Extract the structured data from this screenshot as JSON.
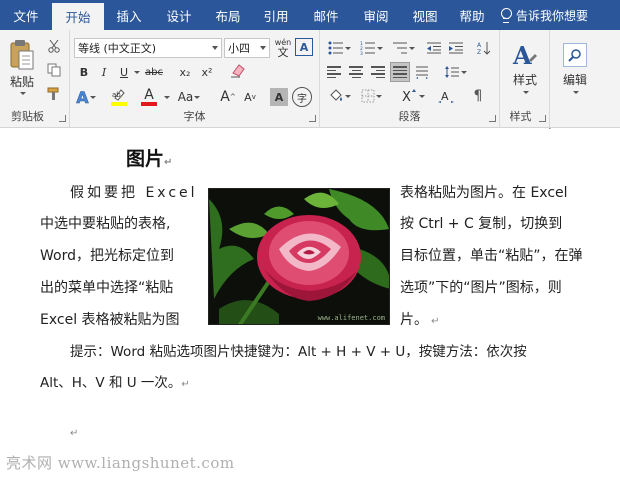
{
  "menu": {
    "tabs": [
      "文件",
      "开始",
      "插入",
      "设计",
      "布局",
      "引用",
      "邮件",
      "审阅",
      "视图",
      "帮助"
    ],
    "active_tab": "开始",
    "tell_me": "告诉我你想要"
  },
  "ribbon": {
    "clipboard": {
      "label": "剪贴板",
      "paste": "粘贴"
    },
    "font": {
      "label": "字体",
      "font_name": "等线 (中文正文)",
      "font_size": "小四",
      "wen_top": "wén",
      "wen_bottom": "文",
      "border_char": "A",
      "bold": "B",
      "italic": "I",
      "underline": "U",
      "strike": "abc",
      "subscript": "x₂",
      "superscript": "x²",
      "grow": "A",
      "shrink": "A",
      "case": "Aa",
      "char_shading": "A",
      "enclose": "字",
      "highlight_color": "#ffff00",
      "font_color": "#e0191c"
    },
    "paragraph": {
      "label": "段落"
    },
    "styles": {
      "label": "样式",
      "button": "样式"
    },
    "editing": {
      "button": "编辑"
    }
  },
  "document": {
    "heading": "图片",
    "lines_left": [
      "假如要把   Excel",
      "中选中要粘贴的表格,",
      "Word，把光标定位到",
      "出的菜单中选择“粘贴",
      "Excel 表格被粘贴为图"
    ],
    "lines_right": [
      "表格粘贴为图片。在 Excel",
      "按 Ctrl + C 复制，切换到",
      "目标位置，单击“粘贴”，在弹",
      "选项”下的“图片”图标，则",
      "片。"
    ],
    "tip_line1": "提示：Word 粘贴选项图片快捷键为：Alt + H + V + U，按键方法：依次按",
    "tip_line2": "Alt、H、V 和 U 一次。",
    "image_caption": "www.alifenet.com",
    "watermark": "亮术网 www.liangshunet.com"
  },
  "icons": [
    "paste-icon",
    "cut-icon",
    "copy-icon",
    "format-painter-icon",
    "clear-format-icon",
    "bullets-icon",
    "numbering-icon",
    "multilevel-list-icon",
    "decrease-indent-icon",
    "increase-indent-icon",
    "align-left-icon",
    "center-icon",
    "align-right-icon",
    "justify-icon",
    "distributed-icon",
    "line-spacing-icon",
    "shading-icon",
    "borders-icon",
    "sort-icon",
    "show-marks-icon",
    "styles-icon",
    "search-icon",
    "mouse-cursor-icon"
  ]
}
